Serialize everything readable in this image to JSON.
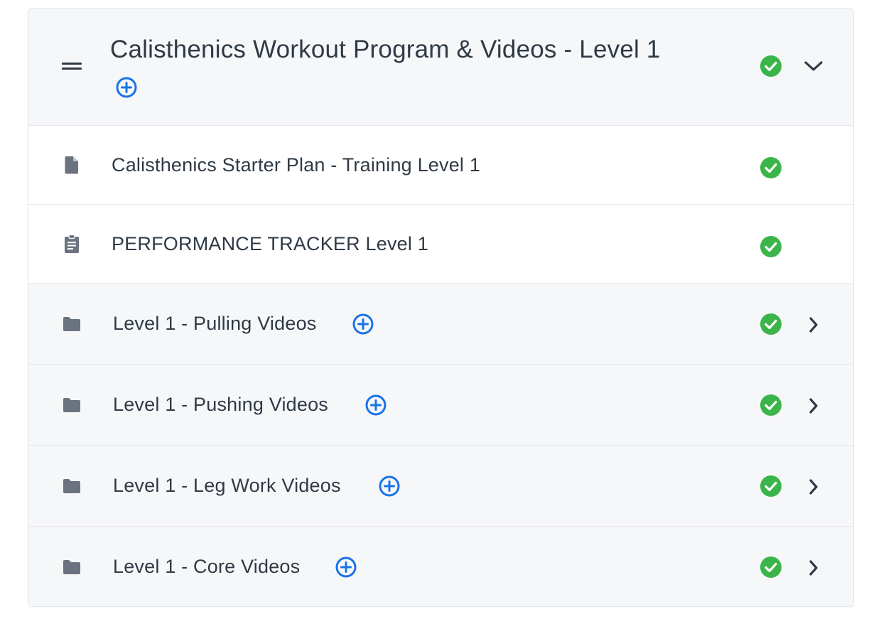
{
  "module": {
    "title": "Calisthenics Workout Program & Videos - Level 1",
    "drag_icon": "drag-handle-icon",
    "add_icon": "add-circle-icon",
    "status_icon": "check-circle-icon",
    "expand_icon": "chevron-down-icon",
    "completed": true,
    "expanded": true
  },
  "items": [
    {
      "type": "file",
      "icon": "document-icon",
      "label": "Calisthenics Starter Plan - Training Level 1",
      "completed": true
    },
    {
      "type": "file",
      "icon": "clipboard-icon",
      "label": "PERFORMANCE TRACKER Level 1",
      "completed": true
    },
    {
      "type": "folder",
      "icon": "folder-icon",
      "label": "Level 1 - Pulling Videos",
      "completed": true
    },
    {
      "type": "folder",
      "icon": "folder-icon",
      "label": "Level 1 - Pushing Videos",
      "completed": true
    },
    {
      "type": "folder",
      "icon": "folder-icon",
      "label": "Level 1 - Leg Work Videos",
      "completed": true
    },
    {
      "type": "folder",
      "icon": "folder-icon",
      "label": "Level 1 - Core Videos",
      "completed": true
    }
  ],
  "colors": {
    "accent_blue": "#1a73e8",
    "success_green": "#3bb54a",
    "icon_gray": "#6b7280",
    "text": "#2f3a45"
  }
}
